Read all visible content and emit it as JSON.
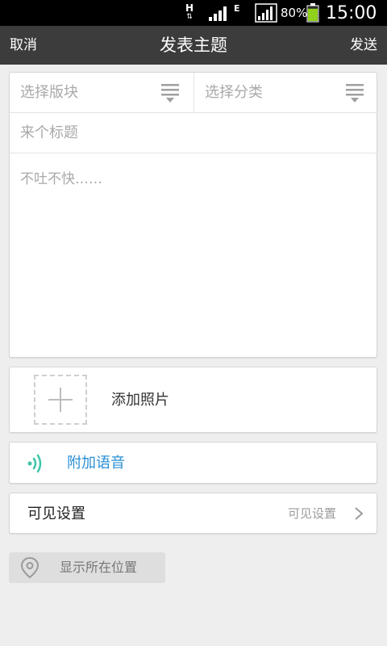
{
  "status_bar": {
    "network_h": "H",
    "network_e": "E",
    "battery_percent": "80%",
    "battery_level": 0.8,
    "time": "15:00",
    "icons": [
      "data-transfer-icon",
      "signal-icon",
      "wifi-icon",
      "battery-icon"
    ]
  },
  "header": {
    "cancel_label": "取消",
    "title": "发表主题",
    "send_label": "发送"
  },
  "form": {
    "board_placeholder": "选择版块",
    "category_placeholder": "选择分类",
    "title_placeholder": "来个标题",
    "body_placeholder": "不吐不快……"
  },
  "photo": {
    "label": "添加照片"
  },
  "voice": {
    "label": "附加语音",
    "accent_color": "#2a8fd6",
    "icon_color": "#3dc6a8"
  },
  "visibility": {
    "label": "可见设置",
    "value": "可见设置"
  },
  "location": {
    "label": "显示所在位置"
  }
}
